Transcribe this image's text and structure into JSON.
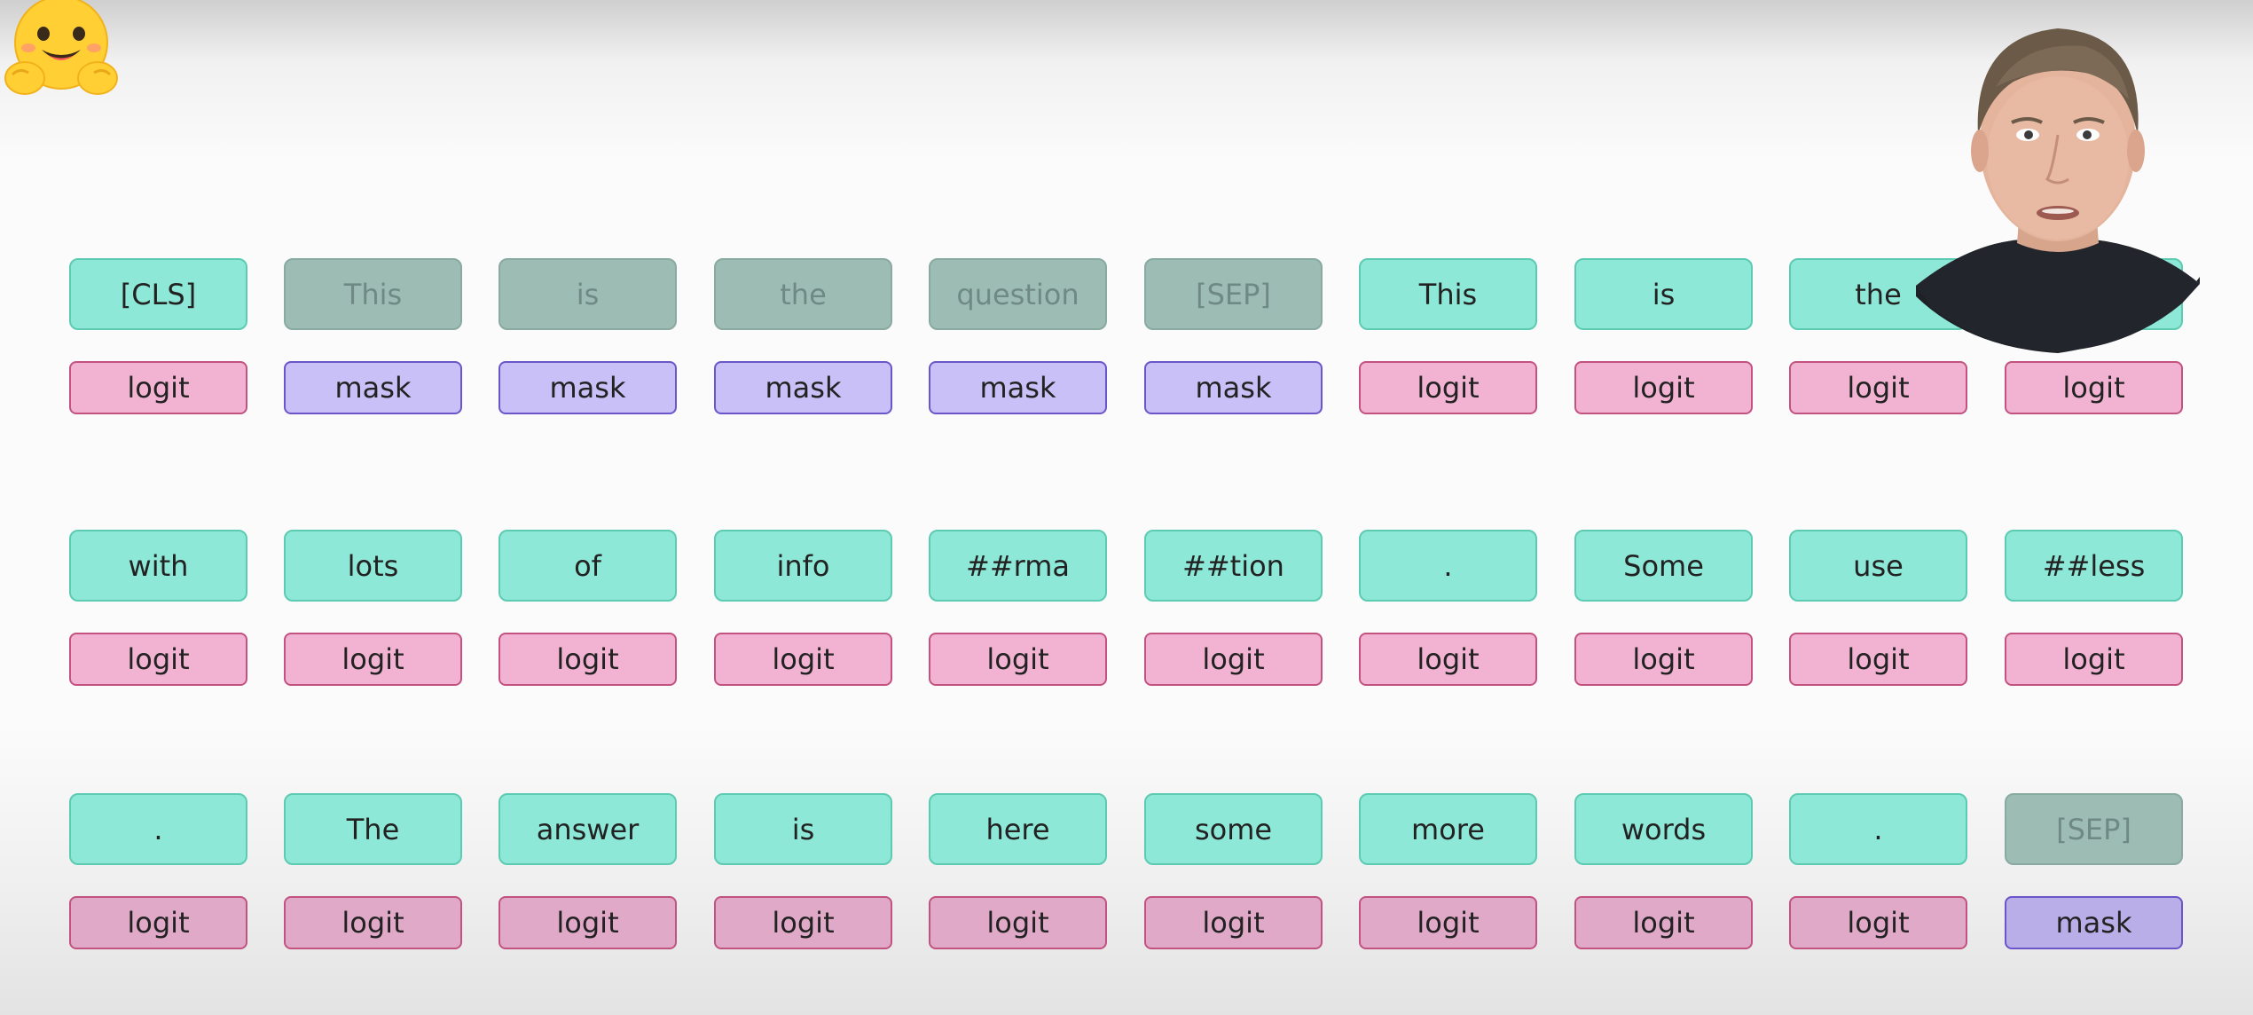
{
  "colors": {
    "token_fill": "#8ee8d7",
    "token_dim_fill": "#9dbdb4",
    "logit_fill": "#f2b3d2",
    "mask_fill": "#c8c0f6"
  },
  "icons": {
    "logo": "hugging-face-emoji-icon",
    "presenter": "presenter-webcam"
  },
  "rows": [
    {
      "tokens": [
        {
          "text": "[CLS]",
          "dim": false,
          "output": "logit"
        },
        {
          "text": "This",
          "dim": true,
          "output": "mask"
        },
        {
          "text": "is",
          "dim": true,
          "output": "mask"
        },
        {
          "text": "the",
          "dim": true,
          "output": "mask"
        },
        {
          "text": "question",
          "dim": true,
          "output": "mask"
        },
        {
          "text": "[SEP]",
          "dim": true,
          "output": "mask"
        },
        {
          "text": "This",
          "dim": false,
          "output": "logit"
        },
        {
          "text": "is",
          "dim": false,
          "output": "logit"
        },
        {
          "text": "the",
          "dim": false,
          "output": "logit"
        },
        {
          "text": "",
          "dim": false,
          "output": "logit"
        }
      ]
    },
    {
      "tokens": [
        {
          "text": "with",
          "dim": false,
          "output": "logit"
        },
        {
          "text": "lots",
          "dim": false,
          "output": "logit"
        },
        {
          "text": "of",
          "dim": false,
          "output": "logit"
        },
        {
          "text": "info",
          "dim": false,
          "output": "logit"
        },
        {
          "text": "##rma",
          "dim": false,
          "output": "logit"
        },
        {
          "text": "##tion",
          "dim": false,
          "output": "logit"
        },
        {
          "text": ".",
          "dim": false,
          "output": "logit"
        },
        {
          "text": "Some",
          "dim": false,
          "output": "logit"
        },
        {
          "text": "use",
          "dim": false,
          "output": "logit"
        },
        {
          "text": "##less",
          "dim": false,
          "output": "logit"
        }
      ]
    },
    {
      "tokens": [
        {
          "text": ".",
          "dim": false,
          "output": "logit"
        },
        {
          "text": "The",
          "dim": false,
          "output": "logit"
        },
        {
          "text": "answer",
          "dim": false,
          "output": "logit"
        },
        {
          "text": "is",
          "dim": false,
          "output": "logit"
        },
        {
          "text": "here",
          "dim": false,
          "output": "logit"
        },
        {
          "text": "some",
          "dim": false,
          "output": "logit"
        },
        {
          "text": "more",
          "dim": false,
          "output": "logit"
        },
        {
          "text": "words",
          "dim": false,
          "output": "logit"
        },
        {
          "text": ".",
          "dim": false,
          "output": "logit"
        },
        {
          "text": "[SEP]",
          "dim": true,
          "output": "mask"
        }
      ]
    }
  ]
}
